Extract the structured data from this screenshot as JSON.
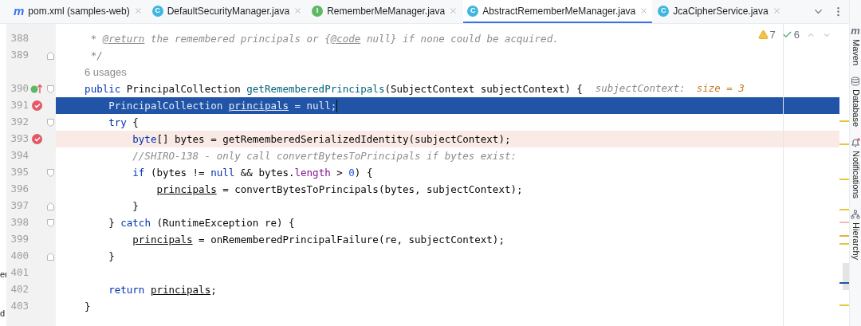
{
  "tabs": [
    {
      "kind": "maven",
      "glyph": "m",
      "label": "pom.xml (samples-web)",
      "selected": false
    },
    {
      "kind": "class",
      "glyph": "C",
      "label": "DefaultSecurityManager.java",
      "selected": false
    },
    {
      "kind": "interface",
      "glyph": "I",
      "label": "RememberMeManager.java",
      "selected": false
    },
    {
      "kind": "class",
      "glyph": "C",
      "label": "AbstractRememberMeManager.java",
      "selected": true
    },
    {
      "kind": "class",
      "glyph": "C",
      "label": "JcaCipherService.java",
      "selected": false
    }
  ],
  "inspections": {
    "warnings": "7",
    "typos": "6"
  },
  "left_panel": [
    "er",
    "d"
  ],
  "lines": [
    {
      "kind": "code",
      "number": "388",
      "tokens": [
        {
          "kind": "comment",
          "text": "     * "
        },
        {
          "kind": "doctag",
          "text": "@return"
        },
        {
          "kind": "comment",
          "text": " the remembered principals or {"
        },
        {
          "kind": "doctag",
          "text": "@code"
        },
        {
          "kind": "comment",
          "text": " null} if none could be acquired."
        }
      ]
    },
    {
      "kind": "code",
      "number": "389",
      "fold_end": true,
      "tokens": [
        {
          "kind": "comment",
          "text": "     */"
        }
      ]
    },
    {
      "kind": "usages",
      "text": "6 usages"
    },
    {
      "kind": "code",
      "number": "390",
      "override": true,
      "fold_start": true,
      "tokens": [
        {
          "kind": "keyword",
          "text": "    public"
        },
        {
          "kind": "plain",
          "text": " PrincipalCollection "
        },
        {
          "kind": "method",
          "text": "getRememberedPrincipals"
        },
        {
          "kind": "plain",
          "text": "(SubjectContext subjectContext) {"
        }
      ],
      "hint": {
        "label": "subjectContext:",
        "value": "size = 3"
      }
    },
    {
      "kind": "code",
      "number": "391",
      "breakpoint": true,
      "current": true,
      "caret": true,
      "tokens": [
        {
          "kind": "plain",
          "text": "        PrincipalCollection "
        },
        {
          "kind": "var",
          "text": "principals"
        },
        {
          "kind": "plain",
          "text": " = null;"
        }
      ]
    },
    {
      "kind": "code",
      "number": "392",
      "fold_start": true,
      "tokens": [
        {
          "kind": "keyword",
          "text": "        try"
        },
        {
          "kind": "plain",
          "text": " {"
        }
      ]
    },
    {
      "kind": "code",
      "number": "393",
      "breakpoint": true,
      "tokens": [
        {
          "kind": "keyword",
          "text": "            byte"
        },
        {
          "kind": "plain",
          "text": "[] bytes = getRememberedSerializedIdentity(subjectContext);"
        }
      ]
    },
    {
      "kind": "code",
      "number": "394",
      "tokens": [
        {
          "kind": "comment",
          "text": "            //SHIRO-138 - only call convertBytesToPrincipals if bytes exist:"
        }
      ]
    },
    {
      "kind": "code",
      "number": "395",
      "fold_start": true,
      "tokens": [
        {
          "kind": "keyword",
          "text": "            if"
        },
        {
          "kind": "plain",
          "text": " (bytes != "
        },
        {
          "kind": "keyword",
          "text": "null"
        },
        {
          "kind": "plain",
          "text": " && bytes."
        },
        {
          "kind": "field",
          "text": "length"
        },
        {
          "kind": "plain",
          "text": " > "
        },
        {
          "kind": "number",
          "text": "0"
        },
        {
          "kind": "plain",
          "text": ") {"
        }
      ]
    },
    {
      "kind": "code",
      "number": "396",
      "tokens": [
        {
          "kind": "var",
          "text": "                principals"
        },
        {
          "kind": "plain",
          "text": " = convertBytesToPrincipals(bytes, subjectContext);"
        }
      ]
    },
    {
      "kind": "code",
      "number": "397",
      "fold_end": true,
      "tokens": [
        {
          "kind": "plain",
          "text": "            }"
        }
      ]
    },
    {
      "kind": "code",
      "number": "398",
      "fold_start": true,
      "tokens": [
        {
          "kind": "plain",
          "text": "        } "
        },
        {
          "kind": "keyword",
          "text": "catch"
        },
        {
          "kind": "plain",
          "text": " (RuntimeException re) {"
        }
      ]
    },
    {
      "kind": "code",
      "number": "399",
      "tokens": [
        {
          "kind": "var",
          "text": "            principals"
        },
        {
          "kind": "plain",
          "text": " = onRememberedPrincipalFailure(re, subjectContext);"
        }
      ]
    },
    {
      "kind": "code",
      "number": "400",
      "fold_end": true,
      "tokens": [
        {
          "kind": "plain",
          "text": "        }"
        }
      ]
    },
    {
      "kind": "code",
      "number": "401"
    },
    {
      "kind": "code",
      "number": "402",
      "tokens": [
        {
          "kind": "keyword",
          "text": "        return "
        },
        {
          "kind": "var",
          "text": "principals"
        },
        {
          "kind": "plain",
          "text": ";"
        }
      ]
    },
    {
      "kind": "code",
      "number": "403",
      "tokens": [
        {
          "kind": "plain",
          "text": "    }"
        }
      ]
    }
  ],
  "tool_windows": [
    {
      "kind": "maven",
      "glyph": "m",
      "label": "Maven"
    },
    {
      "kind": "database",
      "label": "Database"
    },
    {
      "kind": "notifications",
      "label": "Notifications"
    },
    {
      "kind": "hierarchy",
      "label": "Hierarchy"
    }
  ]
}
